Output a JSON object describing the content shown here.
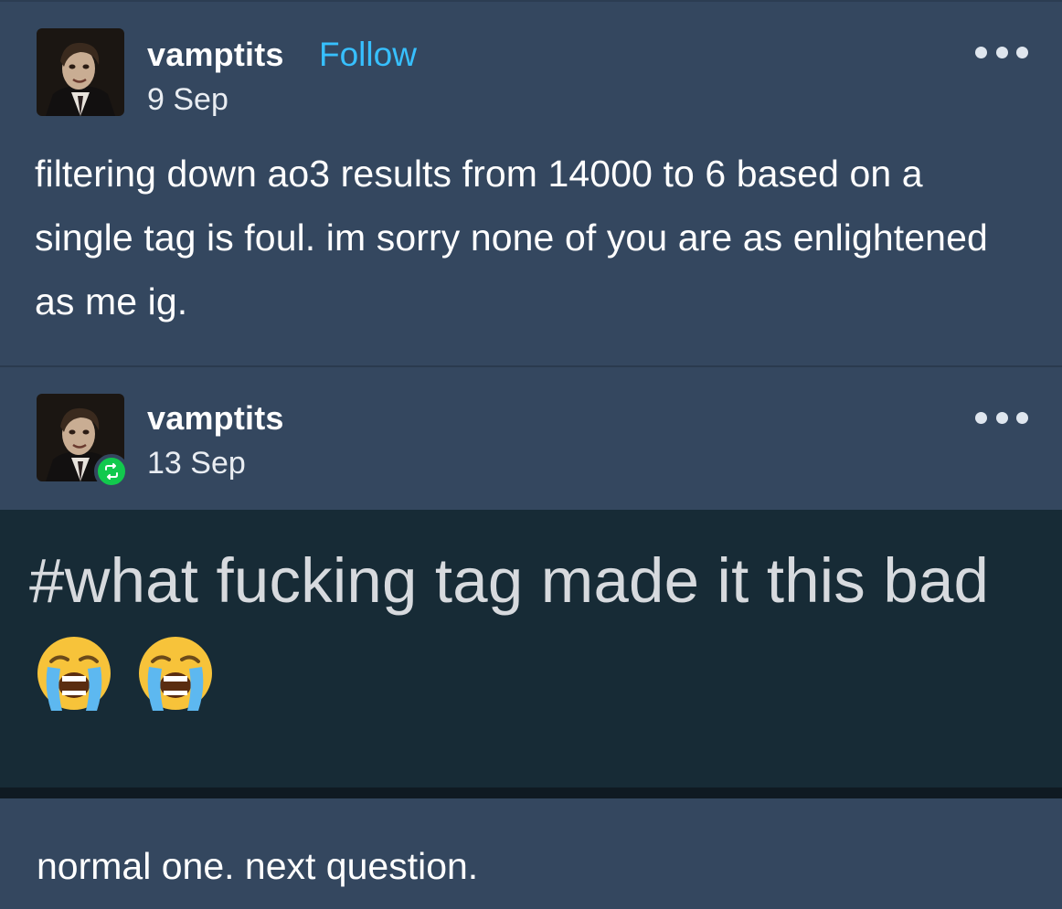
{
  "post1": {
    "username": "vamptits",
    "follow_label": "Follow",
    "date": "9 Sep",
    "body": "filtering down ao3 results from 14000 to 6 based on a single tag is foul. im sorry none of you are as enlightened as me ig.",
    "avatar_icon": "user-avatar"
  },
  "post2": {
    "username": "vamptits",
    "date": "13 Sep",
    "reblog_icon": "reblog-icon",
    "tags": "#what fucking tag made it this bad",
    "emoji_name": "loudly-crying-face"
  },
  "reply": {
    "text": "normal one. next question."
  },
  "colors": {
    "background": "#34475f",
    "follow": "#37c0ff",
    "reblog_badge": "#12c94d",
    "tag_panel": "#172b36"
  }
}
